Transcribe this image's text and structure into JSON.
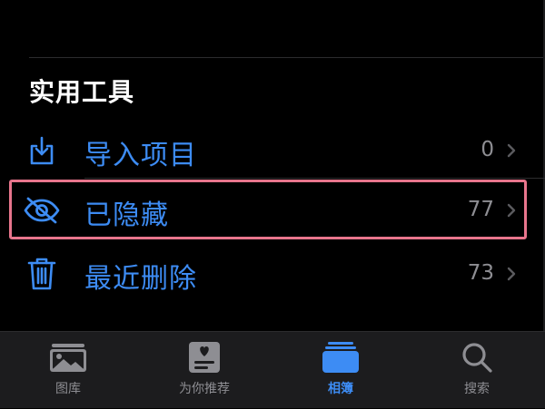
{
  "section": {
    "title": "实用工具"
  },
  "rows": [
    {
      "label": "导入项目",
      "count": "0",
      "icon": "import-icon"
    },
    {
      "label": "已隐藏",
      "count": "77",
      "icon": "eye-slash-icon",
      "highlighted": true
    },
    {
      "label": "最近删除",
      "count": "73",
      "icon": "trash-icon"
    }
  ],
  "tabbar": {
    "tabs": [
      {
        "label": "图库",
        "icon": "photo-library-icon",
        "active": false
      },
      {
        "label": "为你推荐",
        "icon": "for-you-icon",
        "active": false
      },
      {
        "label": "相簿",
        "icon": "albums-icon",
        "active": true
      },
      {
        "label": "搜索",
        "icon": "search-icon",
        "active": false
      }
    ]
  },
  "colors": {
    "accent": "#3d8cf4",
    "background": "#000000",
    "secondary_text": "#8e8e93",
    "tabbar_bg": "#1c1c1e",
    "highlight_border": "#e8758c",
    "inactive_icon": "#8e8e93"
  }
}
